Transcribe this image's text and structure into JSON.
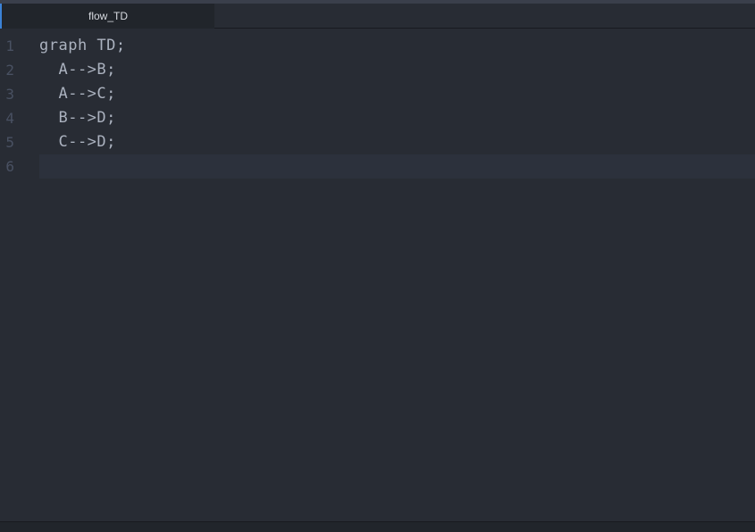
{
  "tab": {
    "label": "flow_TD"
  },
  "editor": {
    "activeLine": 5,
    "lines": [
      {
        "number": "1",
        "content": "graph TD;"
      },
      {
        "number": "2",
        "content": "  A-->B;"
      },
      {
        "number": "3",
        "content": "  A-->C;"
      },
      {
        "number": "4",
        "content": "  B-->D;"
      },
      {
        "number": "5",
        "content": "  C-->D;"
      },
      {
        "number": "6",
        "content": ""
      }
    ]
  }
}
